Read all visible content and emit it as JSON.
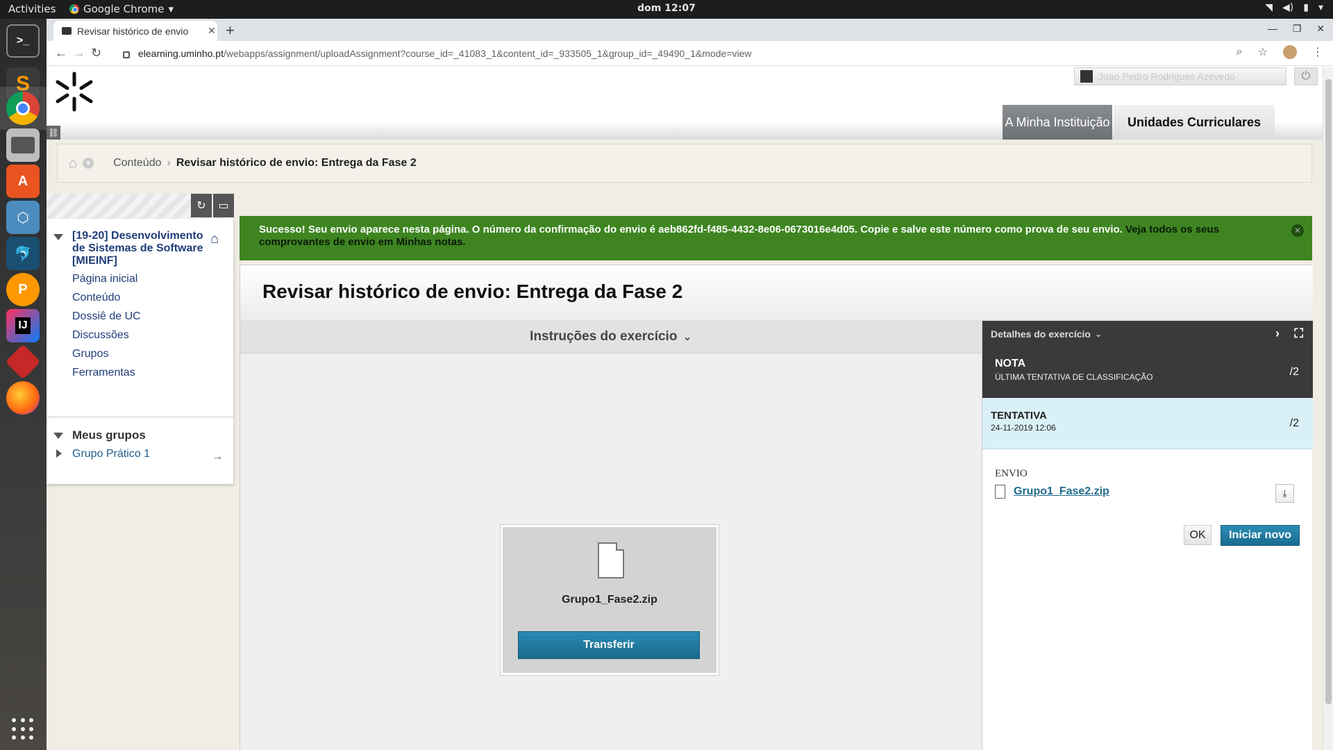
{
  "os": {
    "activities": "Activities",
    "app_name": "Google Chrome",
    "clock": "dom 12:07"
  },
  "browser": {
    "tab_title": "Revisar histórico de envio",
    "url_host": "elearning.uminho.pt",
    "url_path": "/webapps/assignment/uploadAssignment?course_id=_41083_1&content_id=_933505_1&group_id=_49490_1&mode=view"
  },
  "header": {
    "user_name": "Joao Pedro Rodrigues Azevedo",
    "tab_institution": "A Minha Instituição",
    "tab_courses": "Unidades Curriculares"
  },
  "breadcrumb": {
    "item1": "Conteúdo",
    "separator": "›",
    "item2": "Revisar histórico de envio: Entrega da Fase 2"
  },
  "course_menu": {
    "course_title": "[19-20] Desenvolvimento de Sistemas de Software [MIEINF]",
    "items": [
      {
        "label": "Página inicial"
      },
      {
        "label": "Conteúdo"
      },
      {
        "label": "Dossiê de UC"
      },
      {
        "label": "Discussões"
      },
      {
        "label": "Grupos"
      },
      {
        "label": "Ferramentas"
      }
    ],
    "groups_heading": "Meus grupos",
    "group_item": "Grupo Prático 1",
    "group_arrow": "→"
  },
  "banner": {
    "message": "Sucesso! Seu envio aparece nesta página. O número da confirmação do envio é aeb862fd-f485-4432-8e06-0673016e4d05. Copie e salve este número como prova de seu envio.",
    "link": "Veja todos os seus comprovantes de envio em Minhas notas."
  },
  "main": {
    "title": "Revisar histórico de envio: Entrega da Fase 2",
    "instructions": "Instruções do exercício",
    "file_name": "Grupo1_Fase2.zip",
    "download_label": "Transferir"
  },
  "details": {
    "heading": "Detalhes do exercício",
    "grade_label": "NOTA",
    "grade_sub": "ÚLTIMA TENTATIVA DE CLASSIFICAÇÃO",
    "grade_value": "/2",
    "attempt_label": "TENTATIVA",
    "attempt_date": "24-11-2019 12:06",
    "attempt_value": "/2",
    "submission_label": "ENVIO",
    "submission_file": "Grupo1_Fase2.zip",
    "ok_label": "OK",
    "new_label": "Iniciar novo"
  },
  "colors": {
    "success_green": "#3e8521",
    "accent_blue": "#1a6c8f",
    "dark_panel": "#3a3a3a"
  }
}
